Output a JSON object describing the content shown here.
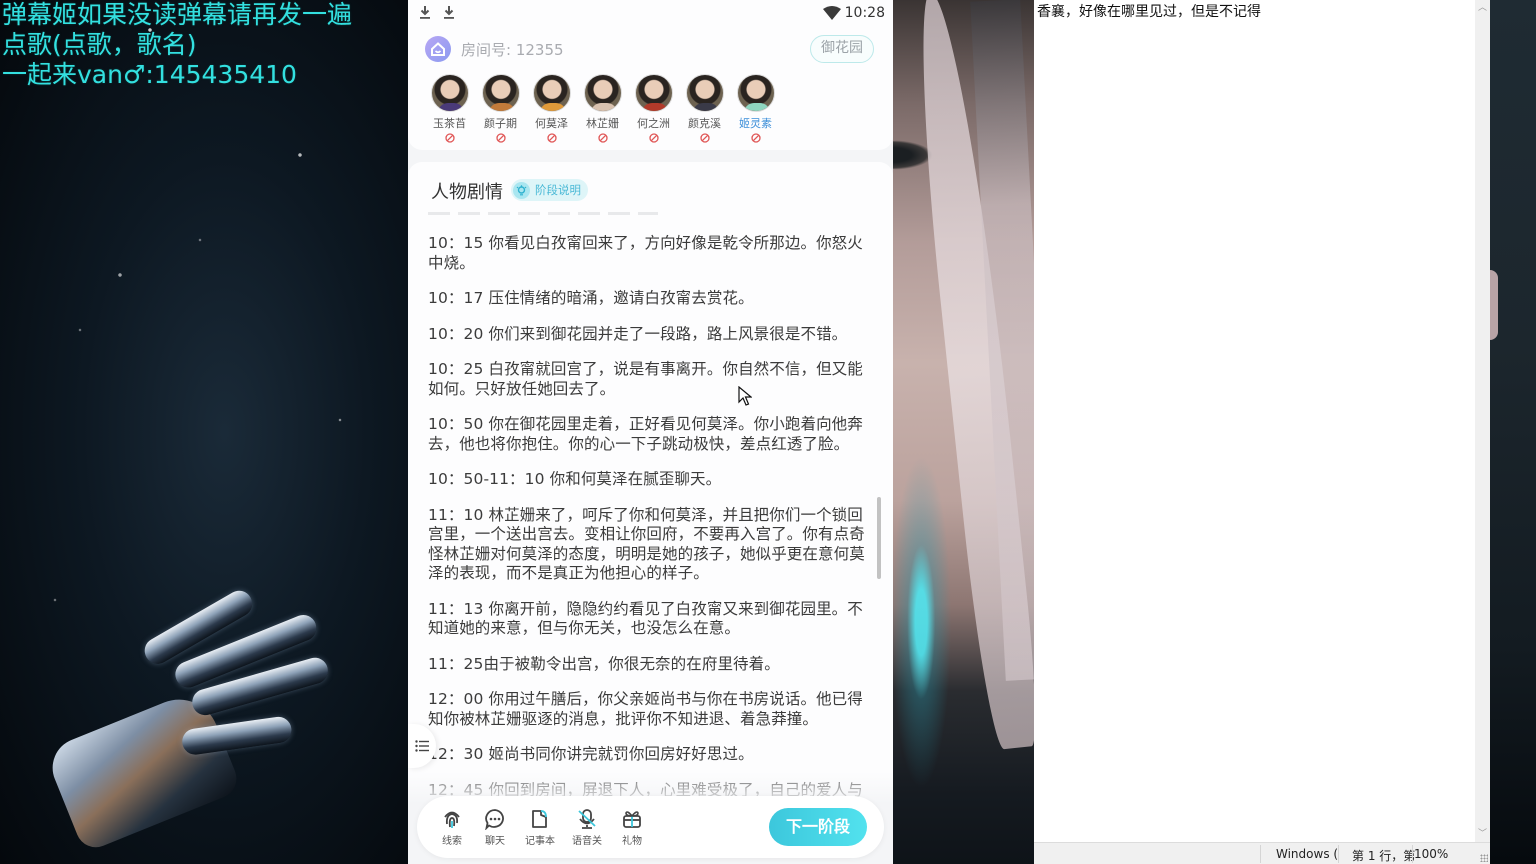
{
  "stream_overlay": {
    "lines": [
      "弹幕姬如果没读弹幕请再发一遍",
      "点歌(点歌，歌名)",
      "一起来van♂:145435410"
    ],
    "color": "#33e0e0"
  },
  "phone": {
    "status_bar": {
      "time": "10:28",
      "icons": [
        "download-icon",
        "download-icon",
        "wifi-icon"
      ]
    },
    "room": {
      "icon": "home-icon",
      "label": "房间号: 12355",
      "scene_button": "御花园"
    },
    "characters": [
      {
        "name": "玉茶苩",
        "active": false,
        "status_icon": "ban-icon"
      },
      {
        "name": "颜子期",
        "active": false,
        "status_icon": "ban-icon"
      },
      {
        "name": "何莫泽",
        "active": false,
        "status_icon": "ban-icon"
      },
      {
        "name": "林芷姗",
        "active": false,
        "status_icon": "ban-icon"
      },
      {
        "name": "何之洲",
        "active": false,
        "status_icon": "ban-icon"
      },
      {
        "name": "颜克溪",
        "active": false,
        "status_icon": "ban-icon"
      },
      {
        "name": "姬灵素",
        "active": true,
        "status_icon": "ban-icon"
      }
    ],
    "story": {
      "title": "人物剧情",
      "phase_chip": "阶段说明",
      "entries": [
        "10：15 你看见白孜甯回来了，方向好像是乾令所那边。你怒火中烧。",
        "10：17 压住情绪的暗涌，邀请白孜甯去赏花。",
        "10：20 你们来到御花园并走了一段路，路上风景很是不错。",
        "10：25 白孜甯就回宫了，说是有事离开。你自然不信，但又能如何。只好放任她回去了。",
        "10：50 你在御花园里走着，正好看见何莫泽。你小跑着向他奔去，他也将你抱住。你的心一下子跳动极快，差点红透了脸。",
        "10：50-11：10 你和何莫泽在腻歪聊天。",
        "11：10 林芷姗来了，呵斥了你和何莫泽，并且把你们一个锁回宫里，一个送出宫去。变相让你回府，不要再入宫了。你有点奇怪林芷姗对何莫泽的态度，明明是她的孩子，她似乎更在意何莫泽的表现，而不是真正为他担心的样子。",
        "11：13 你离开前，隐隐约约看见了白孜甯又来到御花园里。不知道她的来意，但与你无关，也没怎么在意。",
        "11：25由于被勒令出宫，你很无奈的在府里待着。",
        "12：00 你用过午膳后，你父亲姬尚书与你在书房说话。他已得知你被林芷姗驱逐的消息，批评你不知进退、着急莽撞。",
        "12：30 姬尚书同你讲完就罚你回房好好思过。",
        "12：45 你回到房间，屏退下人，心里难受极了，自己的爱人与"
      ]
    },
    "toolbar": {
      "tools": [
        {
          "label": "线索",
          "icon": "fingerprint-icon"
        },
        {
          "label": "聊天",
          "icon": "chat-bubble-icon"
        },
        {
          "label": "记事本",
          "icon": "notepad-icon"
        },
        {
          "label": "语音关",
          "icon": "voice-off-icon"
        },
        {
          "label": "礼物",
          "icon": "gift-icon"
        }
      ],
      "next_button": "下一阶段"
    },
    "accent_color": "#3cc7dc"
  },
  "notepad": {
    "content": "香襄，好像在哪里见过，但是不记得",
    "status_bar": {
      "encoding": "Windows (",
      "position": "第 1 行，第",
      "zoom": "100%"
    }
  }
}
